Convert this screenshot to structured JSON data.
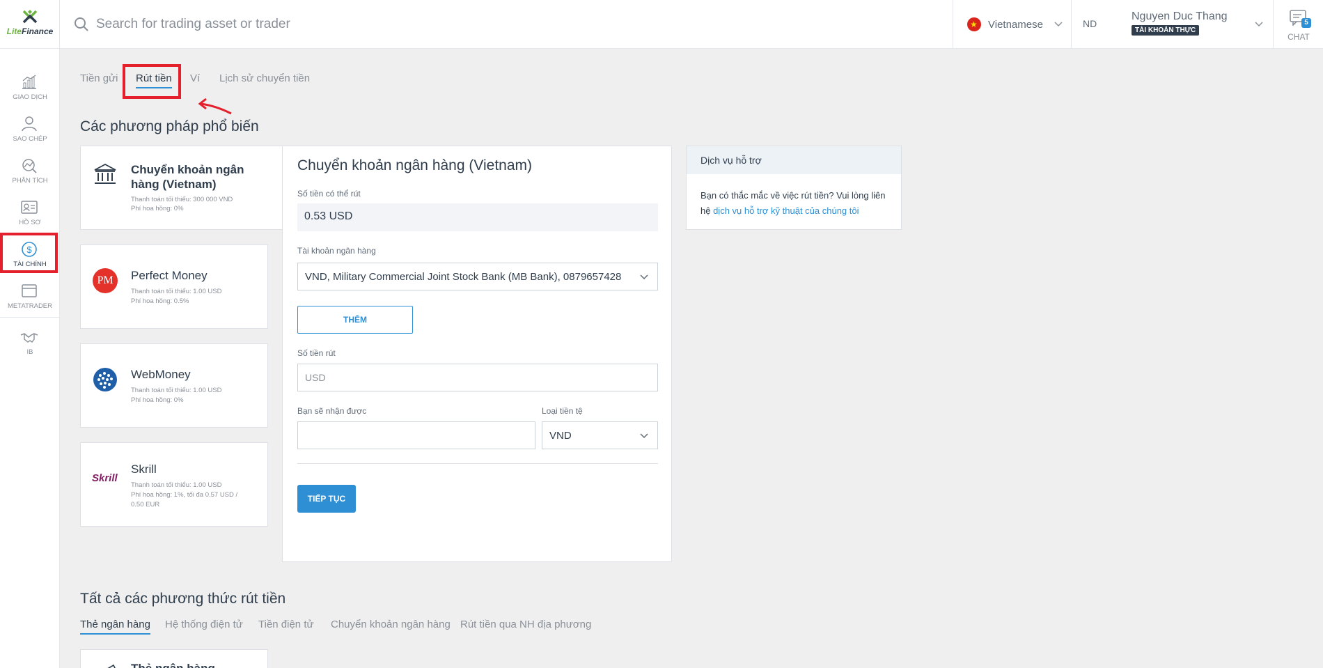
{
  "brand": {
    "name_part1": "Lite",
    "name_part2": "Finance",
    "accent": "#6cb33f"
  },
  "colors": {
    "primary": "#2e8fd4",
    "text": "#2f3d4c",
    "annotation": "#e4202c",
    "background": "#efefef"
  },
  "search": {
    "placeholder": "Search for trading asset or trader"
  },
  "language": {
    "label": "Vietnamese"
  },
  "user": {
    "initials": "ND",
    "name": "Nguyen Duc Thang",
    "account_type": "TÀI KHOẢN THỰC"
  },
  "chat": {
    "label": "CHAT",
    "unread": "5"
  },
  "sidebar": {
    "items": [
      {
        "label": "GIAO DỊCH",
        "icon": "chart-icon"
      },
      {
        "label": "SAO CHÉP",
        "icon": "user-copy-icon"
      },
      {
        "label": "PHÂN TÍCH",
        "icon": "analysis-icon"
      },
      {
        "label": "HỒ SƠ",
        "icon": "profile-card-icon"
      },
      {
        "label": "TÀI CHÍNH",
        "icon": "dollar-icon",
        "active": true
      },
      {
        "label": "METATRADER",
        "icon": "window-icon"
      },
      {
        "label": "IB",
        "icon": "handshake-icon"
      }
    ]
  },
  "tabs": [
    {
      "label": "Tiền gửi"
    },
    {
      "label": "Rút tiền",
      "active": true
    },
    {
      "label": "Ví"
    },
    {
      "label": "Lịch sử chuyển tiền"
    }
  ],
  "popular": {
    "title": "Các phương pháp phổ biến",
    "methods": [
      {
        "name": "Chuyển khoản ngân hàng (Vietnam)",
        "min": "Thanh toán tối thiểu: 300 000 VND",
        "fee": "Phí hoa hồng: 0%",
        "icon": "bank-icon"
      },
      {
        "name": "Perfect Money",
        "min": "Thanh toán tối thiểu: 1.00 USD",
        "fee": "Phí hoa hồng: 0.5%",
        "icon": "perfect-money-icon",
        "icon_text": "PM"
      },
      {
        "name": "WebMoney",
        "min": "Thanh toán tối thiểu: 1.00 USD",
        "fee": "Phí hoa hồng: 0%",
        "icon": "webmoney-icon"
      },
      {
        "name": "Skrill",
        "min": "Thanh toán tối thiểu: 1.00 USD",
        "fee": "Phí hoa hồng: 1%, tối đa 0.57 USD / 0.50 EUR",
        "icon": "skrill-icon",
        "icon_text": "Skrill"
      }
    ]
  },
  "form": {
    "title": "Chuyển khoản ngân hàng (Vietnam)",
    "available_label": "Số tiền có thể rút",
    "available_value": "0.53 USD",
    "bank_account_label": "Tài khoản ngân hàng",
    "bank_account_value": "VND, Military Commercial Joint Stock Bank (MB Bank), 0879657428",
    "add_button": "THÊM",
    "amount_label": "Số tiền rút",
    "amount_placeholder": "USD",
    "receive_label": "Bạn sẽ nhận được",
    "receive_value": "",
    "currency_label": "Loại tiền tệ",
    "currency_value": "VND",
    "continue_button": "TIẾP TỤC"
  },
  "support": {
    "title": "Dịch vụ hỗ trợ",
    "text": "Bạn có thắc mắc về việc rút tiền? Vui lòng liên hệ ",
    "link": "dịch vụ hỗ trợ kỹ thuật của chúng tôi"
  },
  "all_methods": {
    "title": "Tất cả các phương thức rút tiền",
    "tabs": [
      {
        "label": "Thẻ ngân hàng",
        "active": true
      },
      {
        "label": "Hệ thống điện tử"
      },
      {
        "label": "Tiền điện tử"
      },
      {
        "label": "Chuyển khoản ngân hàng"
      },
      {
        "label": "Rút tiền qua NH địa phương"
      }
    ],
    "first_card": {
      "name": "Thẻ ngân hàng",
      "icon": "card-icon"
    }
  }
}
